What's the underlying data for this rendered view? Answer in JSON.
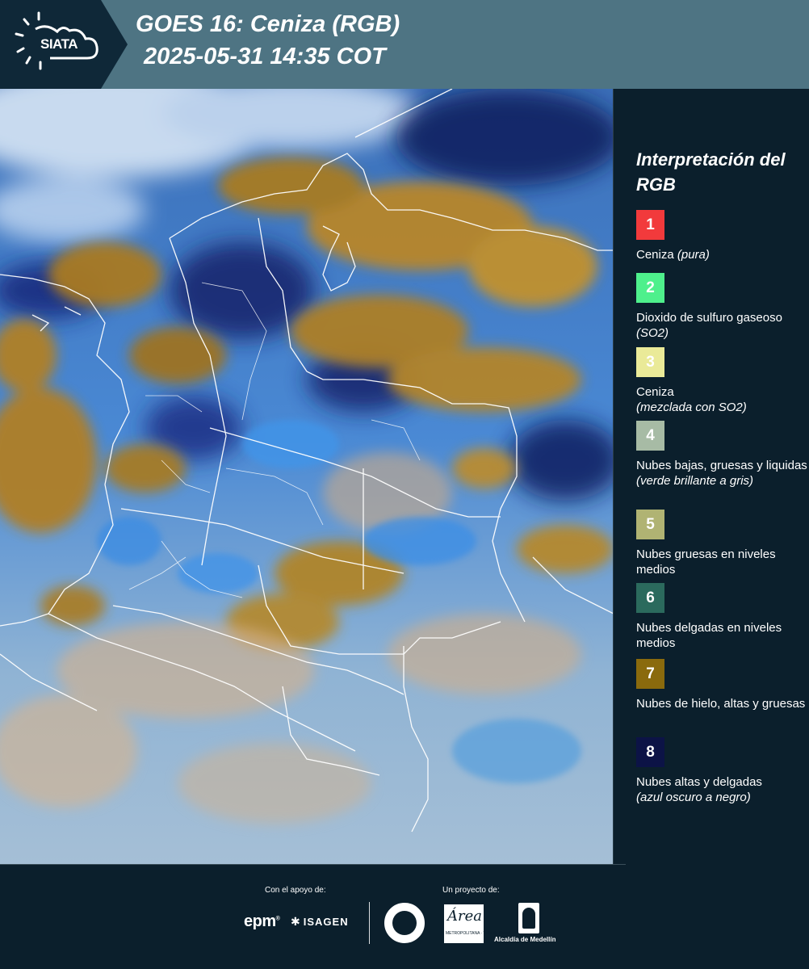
{
  "header": {
    "logo_text": "SIATA",
    "title_line1": "GOES 16: Ceniza (RGB)",
    "title_line2": "2025-05-31 14:35 COT",
    "bg_color": "#4e7483"
  },
  "map": {
    "description_icon": "satellite-ash-rgb-map"
  },
  "legend": {
    "title": "Interpretación del RGB",
    "items": [
      {
        "num": "1",
        "color": "#f23a3c",
        "text_color": "#ffffff",
        "label": "Ceniza",
        "sub": "(pura)"
      },
      {
        "num": "2",
        "color": "#4ef08c",
        "text_color": "#ffffff",
        "label": "Dioxido de sulfuro gaseoso",
        "sub": "(SO2)"
      },
      {
        "num": "3",
        "color": "#eaea98",
        "text_color": "#ffffff",
        "label": "Ceniza",
        "sub": "(mezclada con SO2)"
      },
      {
        "num": "4",
        "color": "#a7bba5",
        "text_color": "#ffffff",
        "label": "Nubes bajas, gruesas y liquidas",
        "sub": "(verde brillante a gris)"
      },
      {
        "num": "5",
        "color": "#b0b373",
        "text_color": "#ffffff",
        "label": "Nubes gruesas en niveles medios",
        "sub": ""
      },
      {
        "num": "6",
        "color": "#2b6a5d",
        "text_color": "#ffffff",
        "label": "Nubes delgadas en niveles medios",
        "sub": ""
      },
      {
        "num": "7",
        "color": "#8a6a0d",
        "text_color": "#ffffff",
        "label": "Nubes de hielo, altas y gruesas",
        "sub": ""
      },
      {
        "num": "8",
        "color": "#0c1346",
        "text_color": "#ffffff",
        "label": "Nubes altas y delgadas",
        "sub": "(azul oscuro a negro)"
      }
    ]
  },
  "footer": {
    "support_label": "Con el apoyo de:",
    "project_label": "Un proyecto de:",
    "epm": "epm",
    "isagen": "ISAGEN",
    "area_script": "Área",
    "area_small": "METROPOLITANA · Valle de Aburrá",
    "alcaldia": "Alcaldía de Medellín"
  }
}
